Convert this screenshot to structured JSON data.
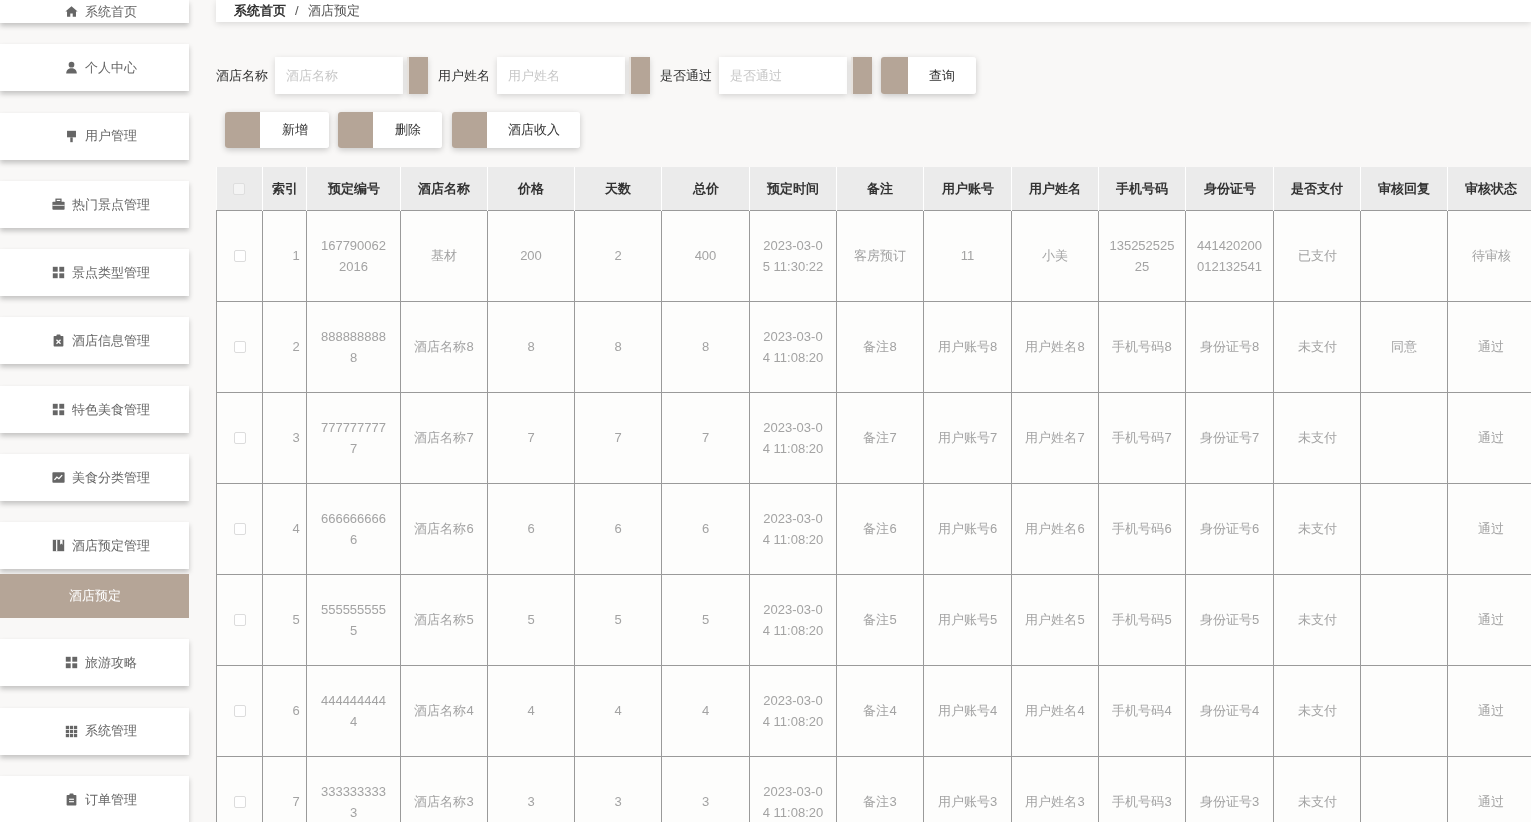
{
  "sidebar": {
    "items": [
      {
        "label": "系统首页",
        "selected": false
      },
      {
        "label": "个人中心",
        "selected": false
      },
      {
        "label": "用户管理",
        "selected": false
      },
      {
        "label": "热门景点管理",
        "selected": false
      },
      {
        "label": "景点类型管理",
        "selected": false
      },
      {
        "label": "酒店信息管理",
        "selected": false
      },
      {
        "label": "特色美食管理",
        "selected": false
      },
      {
        "label": "美食分类管理",
        "selected": false
      },
      {
        "label": "酒店预定管理",
        "selected": false,
        "expanded": true,
        "children": [
          {
            "label": "酒店预定",
            "selected": true
          }
        ]
      },
      {
        "label": "旅游攻略",
        "selected": false
      },
      {
        "label": "系统管理",
        "selected": false
      },
      {
        "label": "订单管理",
        "selected": false
      }
    ]
  },
  "breadcrumb": {
    "items": [
      "系统首页",
      "酒店预定"
    ],
    "separator": "/"
  },
  "filters": [
    {
      "label": "酒店名称",
      "placeholder": "酒店名称"
    },
    {
      "label": "用户姓名",
      "placeholder": "用户姓名"
    },
    {
      "label": "是否通过",
      "placeholder": "是否通过"
    }
  ],
  "search_button": "查询",
  "actions": [
    "新增",
    "删除",
    "酒店收入"
  ],
  "table": {
    "select_all": {
      "checked": false
    },
    "columns": [
      "索引",
      "预定编号",
      "酒店名称",
      "价格",
      "天数",
      "总价",
      "预定时间",
      "备注",
      "用户账号",
      "用户姓名",
      "手机号码",
      "身份证号",
      "是否支付",
      "审核回复",
      "审核状态"
    ],
    "rows": [
      {
        "checked": false,
        "index": "1",
        "booking_no": "1677900622016",
        "hotel_name": "基材",
        "price": "200",
        "days": "2",
        "total": "400",
        "booking_time": "2023-03-05 11:30:22",
        "remark": "客房预订",
        "user_account": "11",
        "user_name": "小美",
        "phone": "13525252525",
        "id_number": "441420200012132541",
        "paid": "已支付",
        "review_status": "待审核"
      },
      {
        "checked": false,
        "index": "2",
        "booking_no": "8888888888",
        "hotel_name": "酒店名称8",
        "price": "8",
        "days": "8",
        "total": "8",
        "booking_time": "2023-03-04 11:08:20",
        "remark": "备注8",
        "user_account": "用户账号8",
        "user_name": "用户姓名8",
        "phone": "手机号码8",
        "id_number": "身份证号8",
        "paid": "未支付",
        "review_reply": "同意",
        "review_status": "通过"
      },
      {
        "checked": false,
        "index": "3",
        "booking_no": "7777777777",
        "hotel_name": "酒店名称7",
        "price": "7",
        "days": "7",
        "total": "7",
        "booking_time": "2023-03-04 11:08:20",
        "remark": "备注7",
        "user_account": "用户账号7",
        "user_name": "用户姓名7",
        "phone": "手机号码7",
        "id_number": "身份证号7",
        "paid": "未支付",
        "review_status": "通过"
      },
      {
        "checked": false,
        "index": "4",
        "booking_no": "6666666666",
        "hotel_name": "酒店名称6",
        "price": "6",
        "days": "6",
        "total": "6",
        "booking_time": "2023-03-04 11:08:20",
        "remark": "备注6",
        "user_account": "用户账号6",
        "user_name": "用户姓名6",
        "phone": "手机号码6",
        "id_number": "身份证号6",
        "paid": "未支付",
        "review_status": "通过"
      },
      {
        "checked": false,
        "index": "5",
        "booking_no": "5555555555",
        "hotel_name": "酒店名称5",
        "price": "5",
        "days": "5",
        "total": "5",
        "booking_time": "2023-03-04 11:08:20",
        "remark": "备注5",
        "user_account": "用户账号5",
        "user_name": "用户姓名5",
        "phone": "手机号码5",
        "id_number": "身份证号5",
        "paid": "未支付",
        "review_status": "通过"
      },
      {
        "checked": false,
        "index": "6",
        "booking_no": "4444444444",
        "hotel_name": "酒店名称4",
        "price": "4",
        "days": "4",
        "total": "4",
        "booking_time": "2023-03-04 11:08:20",
        "remark": "备注4",
        "user_account": "用户账号4",
        "user_name": "用户姓名4",
        "phone": "手机号码4",
        "id_number": "身份证号4",
        "paid": "未支付",
        "review_status": "通过"
      },
      {
        "checked": false,
        "index": "7",
        "booking_no": "3333333333",
        "hotel_name": "酒店名称3",
        "price": "3",
        "days": "3",
        "total": "3",
        "booking_time": "2023-03-04 11:08:20",
        "remark": "备注3",
        "user_account": "用户账号3",
        "user_name": "用户姓名3",
        "phone": "手机号码3",
        "id_number": "身份证号3",
        "paid": "未支付",
        "review_status": "通过"
      }
    ]
  }
}
